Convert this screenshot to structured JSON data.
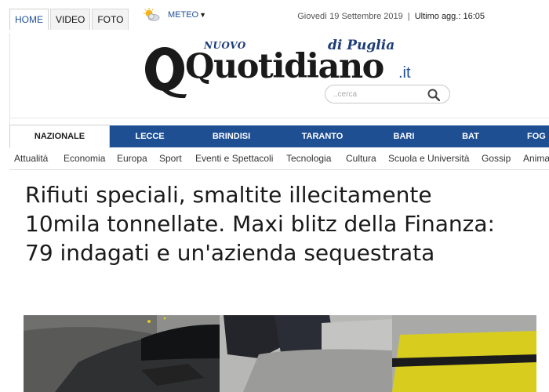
{
  "top_tabs": [
    {
      "label": "HOME",
      "active": true
    },
    {
      "label": "VIDEO",
      "active": false
    },
    {
      "label": "FOTO",
      "active": false
    }
  ],
  "meteo": {
    "label": "METEO",
    "icon": "sun-cloud-icon"
  },
  "date_text": "Giovedì 19 Settembre 2019",
  "separator": "|",
  "update_text": "Ultimo agg.: 16:05",
  "logo": {
    "nuovo": "NUOVO",
    "main": "Quotidiano",
    "di_puglia": "di Puglia",
    "domain": ".it"
  },
  "search": {
    "placeholder": "..cerca"
  },
  "nav": [
    {
      "label": "NAZIONALE",
      "active": true
    },
    {
      "label": "LECCE",
      "active": false
    },
    {
      "label": "BRINDISI",
      "active": false
    },
    {
      "label": "TARANTO",
      "active": false
    },
    {
      "label": "BARI",
      "active": false
    },
    {
      "label": "BAT",
      "active": false
    },
    {
      "label": "FOG",
      "active": false
    }
  ],
  "subnav": [
    {
      "label": "Attualità"
    },
    {
      "label": "Economia"
    },
    {
      "label": "Europa"
    },
    {
      "label": "Sport"
    },
    {
      "label": "Eventi e Spettacoli"
    },
    {
      "label": "Tecnologia"
    },
    {
      "label": "Cultura"
    },
    {
      "label": "Scuola e Università"
    },
    {
      "label": "Gossip"
    },
    {
      "label": "Anima"
    }
  ],
  "article": {
    "title": "Rifiuti speciali, smaltite illecitamente 10mila tonnellate. Maxi blitz della Finanza: 79 indagati e un'azienda sequestrata"
  },
  "colors": {
    "nav_blue": "#1e4f93",
    "logo_blue": "#1d3c78",
    "accent_blue": "#1e4f93"
  }
}
